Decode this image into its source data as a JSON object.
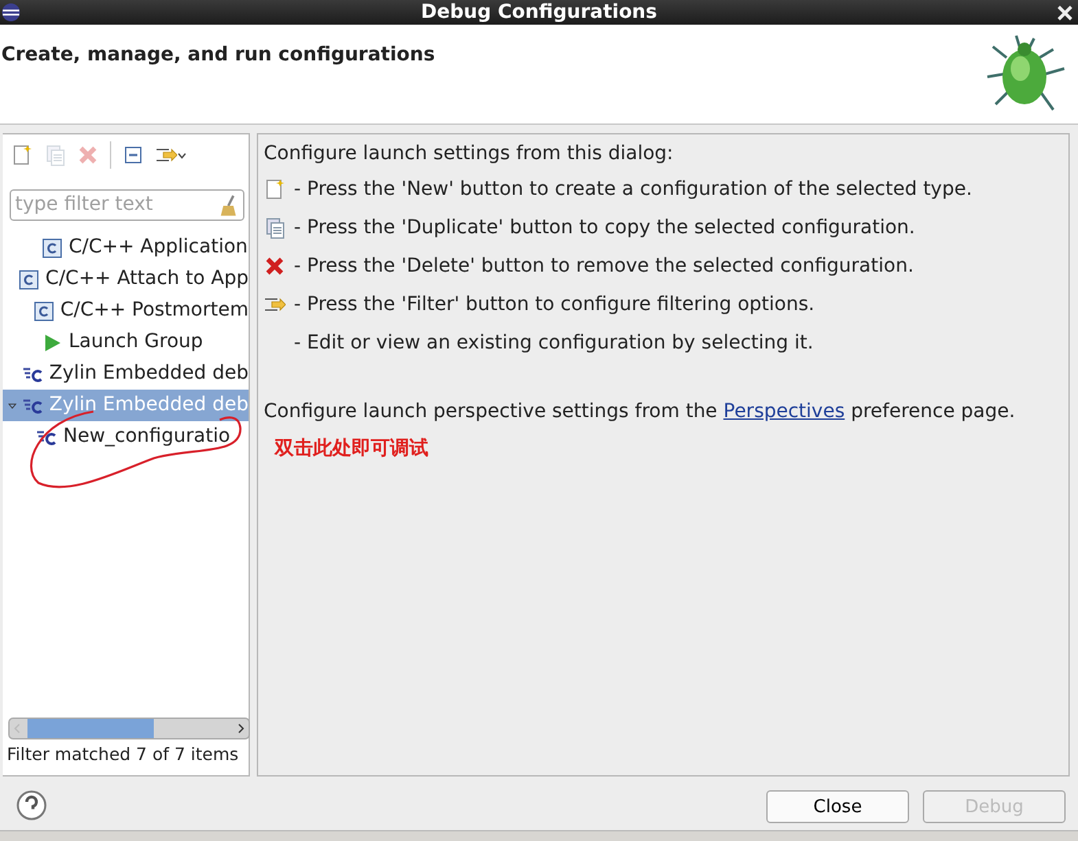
{
  "window": {
    "title": "Debug Configurations"
  },
  "header": {
    "title": "Create, manage, and run configurations"
  },
  "toolbar": [
    {
      "kind": "new",
      "disabled": false
    },
    {
      "kind": "duplicate",
      "disabled": true
    },
    {
      "kind": "delete",
      "disabled": true
    },
    {
      "kind": "collapse",
      "disabled": false
    },
    {
      "kind": "filter",
      "disabled": false
    }
  ],
  "filter": {
    "placeholder": "type filter text"
  },
  "tree": [
    {
      "label": "C/C++ Application",
      "kind": "c-app",
      "selected": false
    },
    {
      "label": "C/C++ Attach to App",
      "kind": "c-app",
      "selected": false
    },
    {
      "label": "C/C++ Postmortem",
      "kind": "c-app",
      "selected": false
    },
    {
      "label": "Launch Group",
      "kind": "launch",
      "selected": false
    },
    {
      "label": "Zylin Embedded deb",
      "kind": "zylin",
      "selected": false
    },
    {
      "label": "Zylin Embedded deb",
      "kind": "zylin",
      "selected": true,
      "expanded": true,
      "children": [
        {
          "label": "New_configuratio",
          "kind": "zylin",
          "selected": false
        }
      ]
    }
  ],
  "filter_status": "Filter matched 7 of 7 items",
  "help": {
    "intro": "Configure launch settings from this dialog:",
    "lines": [
      {
        "kind": "new",
        "text": "- Press the 'New' button to create a configuration of the selected type."
      },
      {
        "kind": "duplicate",
        "text": "- Press the 'Duplicate' button to copy the selected configuration."
      },
      {
        "kind": "delete",
        "text": "- Press the 'Delete' button to remove the selected configuration."
      },
      {
        "kind": "filter",
        "text": "- Press the 'Filter' button to configure filtering options."
      },
      {
        "kind": "none",
        "text": "- Edit or view an existing configuration by selecting it."
      }
    ],
    "perspectives": {
      "before": "Configure launch perspective settings from the ",
      "link": "Perspectives",
      "after": " preference page."
    },
    "annotation": "双击此处即可调试"
  },
  "buttons": [
    {
      "label": "Close",
      "disabled": false
    },
    {
      "label": "Debug",
      "disabled": true
    }
  ]
}
